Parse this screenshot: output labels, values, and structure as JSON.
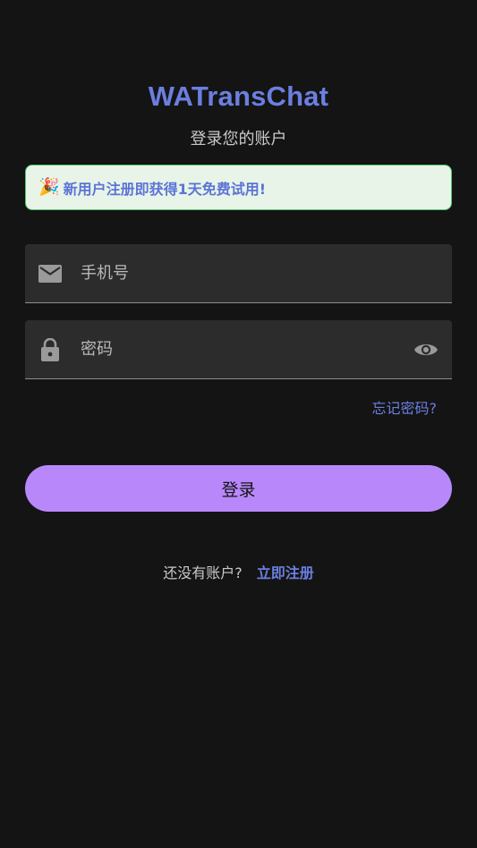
{
  "app": {
    "title": "WATransChat",
    "subtitle": "登录您的账户"
  },
  "promo": {
    "emoji": "🎉",
    "text": "新用户注册即获得1天免费试用!"
  },
  "form": {
    "phone_placeholder": "手机号",
    "phone_icon": "email-icon",
    "password_placeholder": "密码",
    "password_icon": "lock-icon",
    "visibility_icon": "eye-icon",
    "forgot_label": "忘记密码?",
    "login_label": "登录"
  },
  "register": {
    "prompt": "还没有账户?",
    "link": "立即注册"
  },
  "colors": {
    "background": "#141414",
    "accent": "#6b7fe0",
    "button": "#b888fb",
    "promo_bg": "#e8f4e8",
    "promo_border": "#4cc36b",
    "field_bg": "#2c2c2c"
  }
}
